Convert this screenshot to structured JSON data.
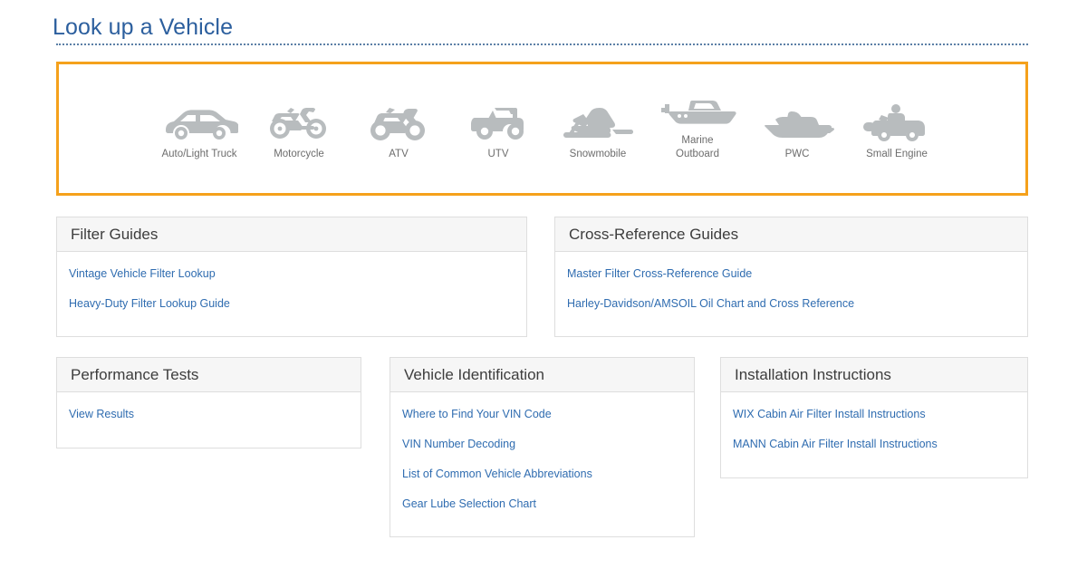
{
  "header": {
    "title": "Look up a Vehicle"
  },
  "colors": {
    "title_blue": "#2c5f9e",
    "panel_orange": "#f5a11b",
    "link_blue": "#2f6cb0",
    "icon_gray": "#b8bcbe",
    "label_gray": "#6d6d6d",
    "card_header_bg": "#f6f6f6",
    "card_border": "#dedede"
  },
  "vehicle_selector": {
    "items": [
      {
        "icon": "car-icon",
        "label": "Auto/Light Truck"
      },
      {
        "icon": "motorcycle-icon",
        "label": "Motorcycle"
      },
      {
        "icon": "atv-icon",
        "label": "ATV"
      },
      {
        "icon": "utv-icon",
        "label": "UTV"
      },
      {
        "icon": "snowmobile-icon",
        "label": "Snowmobile"
      },
      {
        "icon": "boat-icon",
        "label": "Marine\nOutboard"
      },
      {
        "icon": "pwc-icon",
        "label": "PWC"
      },
      {
        "icon": "mower-icon",
        "label": "Small Engine"
      }
    ]
  },
  "cards": {
    "filter_guides": {
      "title": "Filter Guides",
      "links": [
        "Vintage Vehicle Filter Lookup",
        "Heavy-Duty Filter Lookup Guide"
      ]
    },
    "cross_reference_guides": {
      "title": "Cross-Reference Guides",
      "links": [
        "Master Filter Cross-Reference Guide",
        "Harley-Davidson/AMSOIL Oil Chart and Cross Reference"
      ]
    },
    "performance_tests": {
      "title": "Performance Tests",
      "links": [
        "View Results"
      ]
    },
    "vehicle_identification": {
      "title": "Vehicle Identification",
      "links": [
        "Where to Find Your VIN Code",
        "VIN Number Decoding",
        "List of Common Vehicle Abbreviations",
        "Gear Lube Selection Chart"
      ]
    },
    "installation_instructions": {
      "title": "Installation Instructions",
      "links": [
        "WIX Cabin Air Filter Install Instructions",
        "MANN Cabin Air Filter Install Instructions"
      ]
    }
  }
}
